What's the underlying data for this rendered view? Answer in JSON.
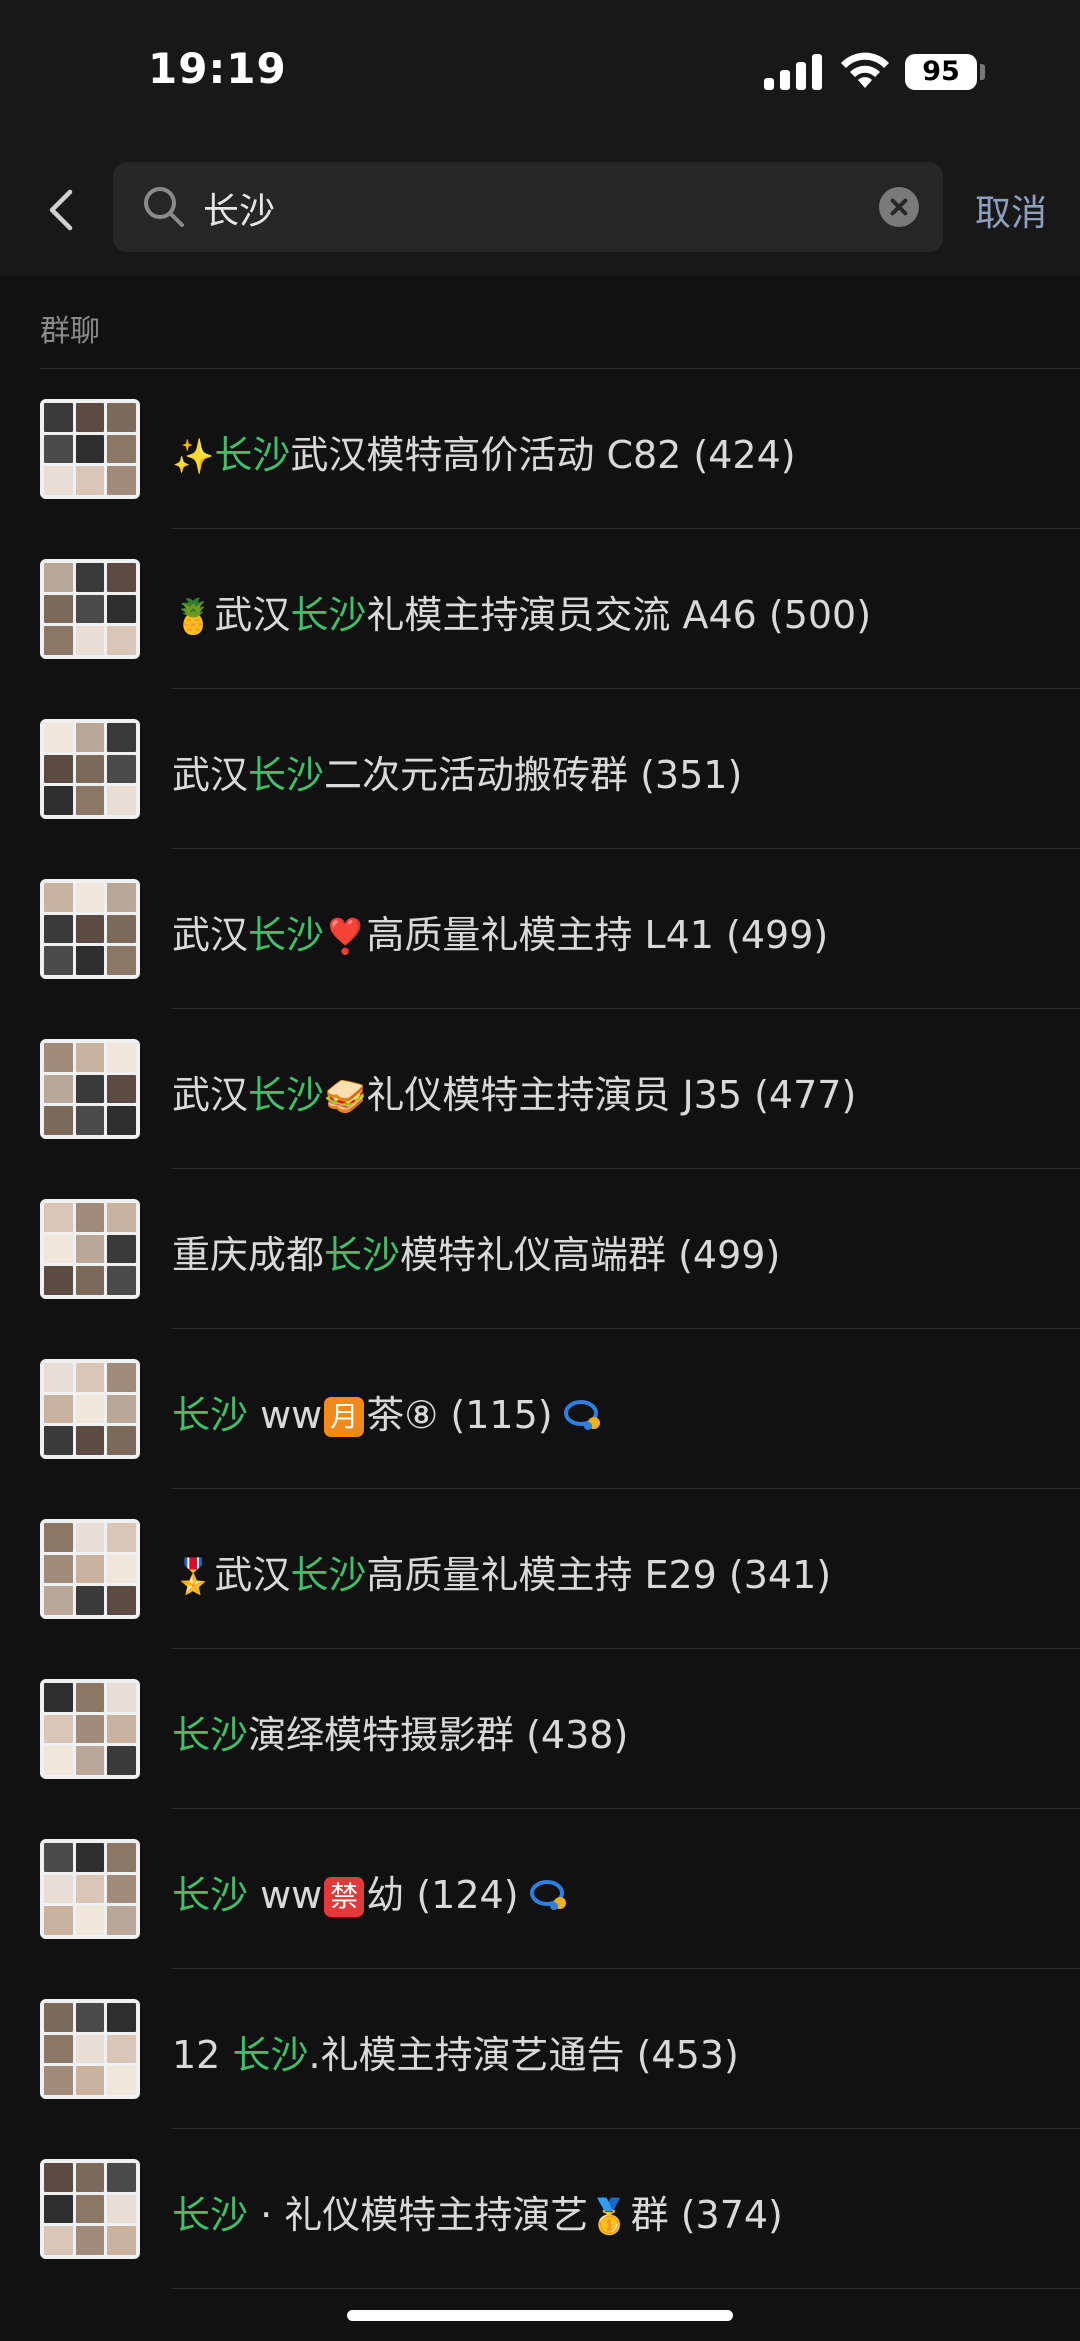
{
  "status_bar": {
    "time": "19:19",
    "battery": "95"
  },
  "search": {
    "query": "长沙",
    "cancel_label": "取消"
  },
  "section": {
    "title": "群聊"
  },
  "groups": [
    {
      "prefix_emoji": "✨",
      "pre": "",
      "hl": "长沙",
      "post": "武汉模特高价活动 C82 (424)"
    },
    {
      "prefix_emoji": "🍍",
      "pre": "武汉",
      "hl": "长沙",
      "post": "礼模主持演员交流 A46 (500)"
    },
    {
      "prefix_emoji": "",
      "pre": "武汉",
      "hl": "长沙",
      "post": "二次元活动搬砖群 (351)"
    },
    {
      "prefix_emoji": "",
      "pre": "武汉",
      "hl": "长沙",
      "mid_emoji": "❣️",
      "post": "高质量礼模主持 L41 (499)"
    },
    {
      "prefix_emoji": "",
      "pre": "武汉",
      "hl": "长沙",
      "mid_emoji": "🥪",
      "post": "礼仪模特主持演员 J35 (477)"
    },
    {
      "prefix_emoji": "",
      "pre": "重庆成都",
      "hl": "长沙",
      "post": "模特礼仪高端群 (499)"
    },
    {
      "prefix_emoji": "",
      "pre": "",
      "hl": "长沙",
      "post_a": " ww",
      "badge": "月",
      "badge_color": "#f08a1c",
      "post": "茶⑧ (115)",
      "has_chat_icon": true
    },
    {
      "prefix_emoji": "🎖️",
      "pre": "武汉",
      "hl": "长沙",
      "post": "高质量礼模主持 E29 (341)"
    },
    {
      "prefix_emoji": "",
      "pre": "",
      "hl": "长沙",
      "post": "演绎模特摄影群 (438)"
    },
    {
      "prefix_emoji": "",
      "pre": "",
      "hl": "长沙",
      "post_a": " ww",
      "badge": "禁",
      "badge_color": "#e03a3a",
      "post": "幼 (124)",
      "has_chat_icon": true
    },
    {
      "prefix_emoji": "",
      "pre": "12 ",
      "hl": "长沙",
      "post": ".礼模主持演艺通告 (453)"
    },
    {
      "prefix_emoji": "",
      "pre": "",
      "hl": "长沙",
      "post_a": " · 礼仪模特主持演艺",
      "mid_emoji2": "🥇",
      "post": "群 (374)"
    }
  ],
  "colors": {
    "highlight": "#3fbf6a",
    "cancel": "#8fa0bf",
    "background": "#111111"
  },
  "icons": [
    "back-chevron-icon",
    "search-icon",
    "clear-icon",
    "group-chat-icon"
  ]
}
